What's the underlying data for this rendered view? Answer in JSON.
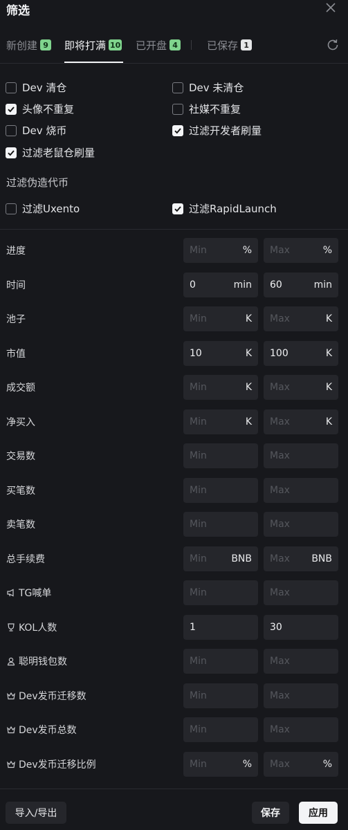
{
  "header": {
    "title": "筛选"
  },
  "tabs": [
    {
      "label": "新创建",
      "badge": "9"
    },
    {
      "label": "即将打满",
      "badge": "10"
    },
    {
      "label": "已开盘",
      "badge": "4"
    },
    {
      "label": "已保存",
      "badge": "1"
    }
  ],
  "checkboxes": [
    {
      "label": "Dev 清仓",
      "checked": false
    },
    {
      "label": "Dev 未清仓",
      "checked": false
    },
    {
      "label": "头像不重复",
      "checked": true
    },
    {
      "label": "社媒不重复",
      "checked": false
    },
    {
      "label": "Dev 烧币",
      "checked": false
    },
    {
      "label": "过滤开发者刷量",
      "checked": true
    },
    {
      "label": "过滤老鼠仓刷量",
      "checked": true
    }
  ],
  "fake_section": {
    "title": "过滤伪造代币",
    "options": [
      {
        "label": "过滤Uxento",
        "checked": false
      },
      {
        "label": "过滤RapidLaunch",
        "checked": true
      }
    ]
  },
  "filters": [
    {
      "label": "进度",
      "min": "",
      "max": "",
      "min_ph": "Min",
      "max_ph": "Max",
      "unit": "%"
    },
    {
      "label": "时间",
      "min": "0",
      "max": "60",
      "min_ph": "Min",
      "max_ph": "Max",
      "unit": "min"
    },
    {
      "label": "池子",
      "min": "",
      "max": "",
      "min_ph": "Min",
      "max_ph": "Max",
      "unit": "K"
    },
    {
      "label": "市值",
      "min": "10",
      "max": "100",
      "min_ph": "Min",
      "max_ph": "Max",
      "unit": "K"
    },
    {
      "label": "成交额",
      "min": "",
      "max": "",
      "min_ph": "Min",
      "max_ph": "Max",
      "unit": "K"
    },
    {
      "label": "净买入",
      "min": "",
      "max": "",
      "min_ph": "Min",
      "max_ph": "Max",
      "unit": "K"
    },
    {
      "label": "交易数",
      "min": "",
      "max": "",
      "min_ph": "Min",
      "max_ph": "Max",
      "unit": ""
    },
    {
      "label": "买笔数",
      "min": "",
      "max": "",
      "min_ph": "Min",
      "max_ph": "Max",
      "unit": ""
    },
    {
      "label": "卖笔数",
      "min": "",
      "max": "",
      "min_ph": "Min",
      "max_ph": "Max",
      "unit": ""
    },
    {
      "label": "总手续费",
      "min": "",
      "max": "",
      "min_ph": "Min",
      "max_ph": "Max",
      "unit": "BNB"
    },
    {
      "label": "TG喊单",
      "icon": "megaphone-icon",
      "min": "",
      "max": "",
      "min_ph": "Min",
      "max_ph": "Max",
      "unit": ""
    },
    {
      "label": "KOL人数",
      "icon": "trophy-icon",
      "min": "1",
      "max": "30",
      "min_ph": "Min",
      "max_ph": "Max",
      "unit": ""
    },
    {
      "label": "聪明钱包数",
      "icon": "user-icon",
      "min": "",
      "max": "",
      "min_ph": "Min",
      "max_ph": "Max",
      "unit": ""
    },
    {
      "label": "Dev发币迁移数",
      "icon": "crown-icon",
      "min": "",
      "max": "",
      "min_ph": "Min",
      "max_ph": "Max",
      "unit": ""
    },
    {
      "label": "Dev发币总数",
      "icon": "crown-icon",
      "min": "",
      "max": "",
      "min_ph": "Min",
      "max_ph": "Max",
      "unit": ""
    },
    {
      "label": "Dev发币迁移比例",
      "icon": "crown-icon",
      "min": "",
      "max": "",
      "min_ph": "Min",
      "max_ph": "Max",
      "unit": "%"
    }
  ],
  "footer": {
    "import_export": "导入/导出",
    "save": "保存",
    "apply": "应用"
  },
  "colors": {
    "background": "#17181c",
    "input_bg": "#25262b",
    "badge_green": "#7fd48d",
    "text": "#e6e7ea"
  }
}
